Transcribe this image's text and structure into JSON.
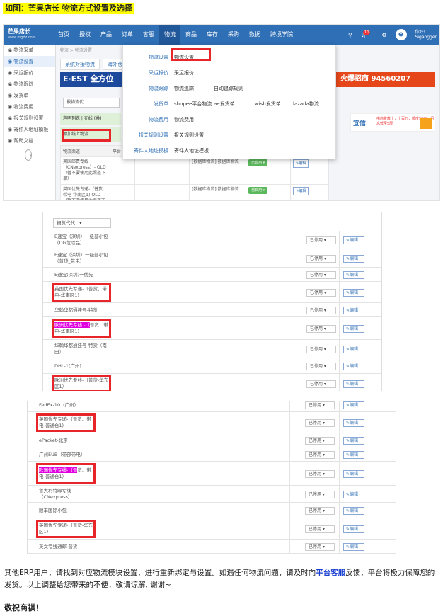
{
  "caption": "如图：芒果店长 物流方式设置及选择",
  "header": {
    "logo": "芒果店长",
    "logo_sub": "www.mgdz.com",
    "nav": [
      "首页",
      "授权",
      "产品",
      "订单",
      "客服",
      "物流",
      "商品",
      "库存",
      "采购",
      "数据",
      "跨境学院"
    ],
    "active_nav": "物流",
    "badge": "10",
    "user_line1": "你好!",
    "user_line2": "Sigaogger"
  },
  "sidebar": {
    "items": [
      "物流采单",
      "物流设置",
      "采运报价",
      "物流跟踪",
      "发货单",
      "物流费用",
      "报关规则设置",
      "寄件人地址模板",
      "帮助文档"
    ],
    "active": "物流设置"
  },
  "crumb": "物流 > 物流设置",
  "tabs": [
    "系统对接物流",
    "海外仓"
  ],
  "banner_left": "E·EST 全方位",
  "banner_right": "火爆招商 94560207",
  "banner_side": {
    "title": "宜信",
    "sub": "电商贷款上，上百万，额度50万，月息低至5厘"
  },
  "filter_label": "报物流代",
  "group_label": "声明列表 | 在线 (共)",
  "group_label2": "添加线上物流",
  "table": {
    "headers": [
      "物流渠道",
      "平台",
      "承运商(国内)",
      "打单模版",
      "状态",
      "操作"
    ],
    "rows": [
      {
        "name": "英国邮费专线（CNexpress）- OLD（暂不要使用此渠道下单）",
        "tpl": "[数据库物流] 数据库物流",
        "status": "已启用",
        "action": "编辑"
      },
      {
        "name": "英国优先专递-（普货、带电-华南区1)-OLD（暂不要使用此渠道下单）",
        "tpl": "[数据库物流] 数据库物流",
        "status": "已启用",
        "action": "编辑"
      }
    ]
  },
  "dropdown": [
    {
      "cat": "物流设置",
      "items": [
        "物流设置"
      ]
    },
    {
      "cat": "采运报价",
      "items": [
        "采运报价"
      ]
    },
    {
      "cat": "物流跟踪",
      "items": [
        "物流追踪",
        "自动追踪规则"
      ]
    },
    {
      "cat": "发货单",
      "items": [
        "shopee平台物流",
        "ae发货单",
        "wish发货单",
        "lazada物流"
      ]
    },
    {
      "cat": "物流费用",
      "items": [
        "物流费用"
      ]
    },
    {
      "cat": "报关规则设置",
      "items": [
        "报关规则设置"
      ]
    },
    {
      "cat": "寄件人地址模板",
      "items": [
        "寄件人地址模板"
      ]
    }
  ],
  "shot2": {
    "filter": "报货代代",
    "rows": [
      {
        "name": "E速宝（深圳）一级部小包（DG危险品）",
        "status": "已停用",
        "action": "编辑"
      },
      {
        "name": "E速宝（深圳）一级部小包（普货_带电）",
        "status": "已停用",
        "action": "编辑"
      },
      {
        "name": "E速宝(深圳)一优先",
        "status": "已停用",
        "action": "编辑"
      },
      {
        "name": "英国优先专递-（普货、带电-华南区1)",
        "status": "已停用",
        "action": "编辑"
      },
      {
        "name": "华翰华都通挂号-特货",
        "status": "已停用",
        "action": "编辑"
      },
      {
        "name": "欧洲优先专线 -（普货、带电-华南区1）",
        "status": "已停用",
        "action": "编辑"
      },
      {
        "name": "华翰华都通挂号-特货（南田）",
        "status": "已停用",
        "action": "编辑"
      },
      {
        "name": "DHL-1(广州)",
        "status": "已停用",
        "action": "编辑"
      },
      {
        "name": "欧洲优先专线-（普货-华东区1）",
        "status": "已停用",
        "action": "编辑"
      }
    ]
  },
  "shot3": {
    "rows": [
      {
        "name": "FedEx-10（广州）",
        "status": "已停用",
        "action": "编辑"
      },
      {
        "name": "英国优先专递-（普货、带电-普通仓1)",
        "status": "已停用",
        "action": "编辑"
      },
      {
        "name": "ePacket-北京",
        "status": "已停用",
        "action": "编辑"
      },
      {
        "name": "广州EUB（带部带电）",
        "status": "已停用",
        "action": "编辑"
      },
      {
        "name": "欧洲优先专线-（普货、带电-普通仓1）",
        "status": "已停用",
        "action": "编辑"
      },
      {
        "name": "鲁大利特邮专线（CNexpress）",
        "status": "已停用",
        "action": "编辑"
      },
      {
        "name": "顺丰国际小包",
        "status": "已停用",
        "action": "编辑"
      },
      {
        "name": "英国优先专递-（普货-华东区1)",
        "status": "已停用",
        "action": "编辑"
      },
      {
        "name": "英文专线通邮-普货",
        "status": "已停用",
        "action": "编辑"
      }
    ]
  },
  "body_text_1": "其他ERP用户，请找到对应物流模块设置，进行重新绑定与设置。如遇任何物流问题，请及时向",
  "body_link": "平台客服",
  "body_text_2": "反馈，平台将极力保障您的发货。以上调整给您带来的不便，敬请谅解, 谢谢~",
  "closing": "敬祝商祺！",
  "colors": {
    "brand": "#2f6fb5",
    "highlight_box": "#e8262a",
    "caption_bg": "#ffff00",
    "text_highlight": "#e000e0"
  }
}
